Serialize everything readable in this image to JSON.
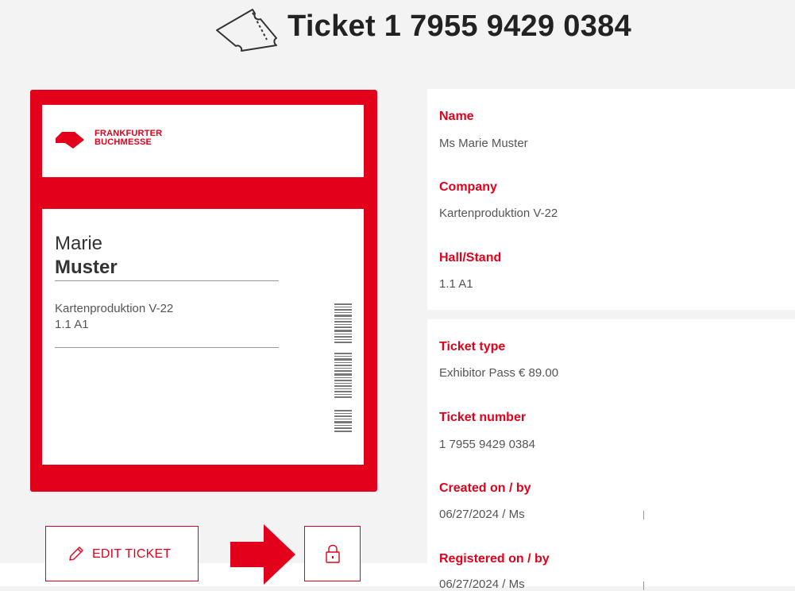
{
  "header": {
    "title": "Ticket 1 7955 9429 0384",
    "icon": "ticket-icon"
  },
  "badge": {
    "logo_line1": "FRANKFURTER",
    "logo_line2": "BUCHMESSE",
    "first_name": "Marie",
    "last_name": "Muster",
    "company": "Kartenproduktion V-22",
    "stand": "1.1 A1",
    "brand_color": "#e2001a"
  },
  "actions": {
    "edit_label": "EDIT TICKET",
    "edit_icon": "pencil-icon",
    "lock_icon": "lock-icon",
    "arrow_icon": "arrow-right-icon"
  },
  "details": {
    "name_label": "Name",
    "name_value": "Ms Marie Muster",
    "company_label": "Company",
    "company_value": "Kartenproduktion V-22",
    "hall_label": "Hall/Stand",
    "hall_value": "1.1 A1",
    "type_label": "Ticket type",
    "type_value": "Exhibitor Pass € 89.00",
    "number_label": "Ticket number",
    "number_value": "1 7955 9429 0384",
    "created_label": "Created on / by",
    "created_value": "06/27/2024 / Ms",
    "registered_label": "Registered on / by",
    "registered_value": "06/27/2024 / Ms"
  }
}
